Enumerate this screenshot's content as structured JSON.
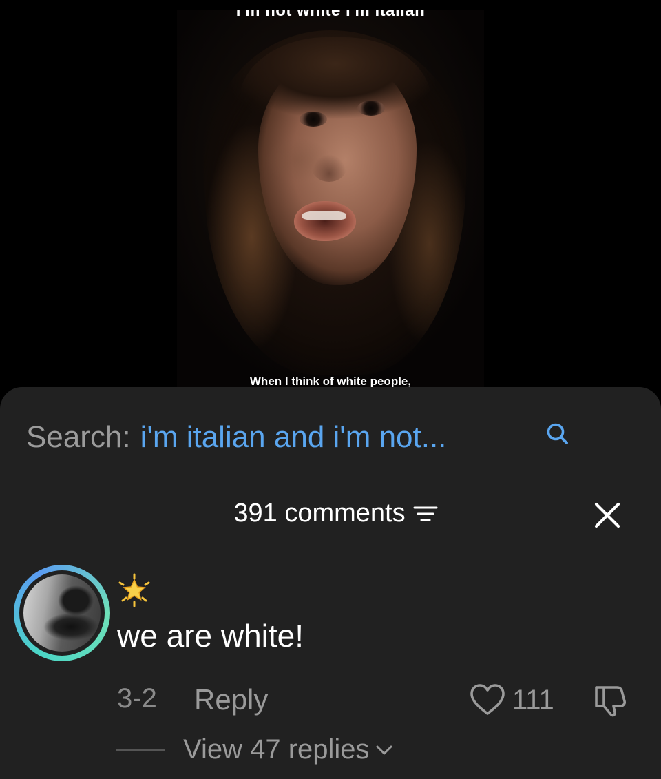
{
  "video": {
    "caption_top": "I'm not white I'm Italian",
    "caption_bottom": "When I think of white people,"
  },
  "search": {
    "prefix": "Search:",
    "query": "i'm italian and i'm not..."
  },
  "comments_header": {
    "count": "391 comments"
  },
  "comment": {
    "name_emoji": "🌟",
    "text": "we are white!",
    "date": "3-2",
    "reply_label": "Reply",
    "likes": "111",
    "view_replies": "View 47 replies"
  },
  "icons": {
    "search": "search-icon",
    "sort": "sort-icon",
    "close": "close-icon",
    "heart": "heart-icon",
    "dislike": "thumbs-down-icon",
    "chevron": "chevron-down-icon"
  },
  "colors": {
    "sheet_bg": "#212121",
    "search_query": "#5aa6f0",
    "muted": "#9a9a9a",
    "ring_start": "#4bd6c6",
    "ring_end": "#5b9cf2"
  }
}
